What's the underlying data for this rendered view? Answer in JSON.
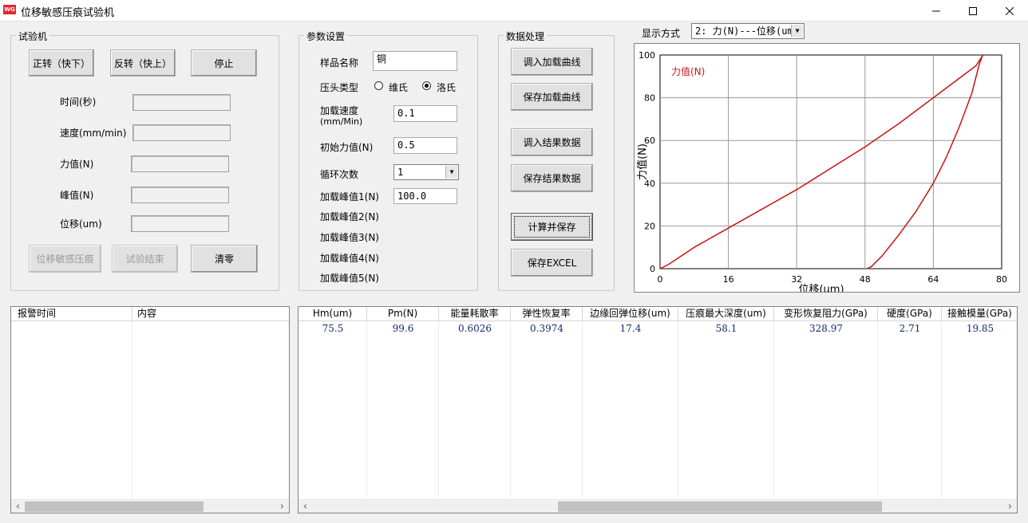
{
  "window": {
    "title": "位移敏感压痕试验机",
    "icon_text": "WG"
  },
  "machine": {
    "title": "试验机",
    "btn_forward": "正转（快下）",
    "btn_reverse": "反转（快上）",
    "btn_stop": "停止",
    "lbl_time": "时间(秒)",
    "lbl_speed": "速度(mm/min)",
    "lbl_force": "力值(N)",
    "lbl_peak": "峰值(N)",
    "lbl_disp": "位移(um)",
    "btn_indent": "位移敏感压痕",
    "btn_end": "试验结束",
    "btn_zero": "清零"
  },
  "params": {
    "title": "参数设置",
    "sample_label": "样品名称",
    "sample_value": "铜",
    "indenter_label": "压头类型",
    "opt_vickers": "维氏",
    "opt_rockwell": "洛氏",
    "selected": "洛氏",
    "speed_label_1": "加载速度",
    "speed_label_2": "(mm/Min)",
    "speed_value": "0.1",
    "init_label": "初始力值(N)",
    "init_value": "0.5",
    "cycle_label": "循环次数",
    "cycle_value": "1",
    "peak1_label": "加载峰值1(N)",
    "peak1_value": "100.0",
    "peak2_label": "加载峰值2(N)",
    "peak3_label": "加载峰值3(N)",
    "peak4_label": "加载峰值4(N)",
    "peak5_label": "加载峰值5(N)"
  },
  "processing": {
    "title": "数据处理",
    "btn_load_curve": "调入加载曲线",
    "btn_save_curve": "保存加载曲线",
    "btn_load_result": "调入结果数据",
    "btn_save_result": "保存结果数据",
    "btn_calc": "计算并保存",
    "btn_excel": "保存EXCEL"
  },
  "display": {
    "label": "显示方式",
    "value": "2: 力(N)---位移(um"
  },
  "chart_data": {
    "type": "line",
    "ylabel": "力值(N)",
    "xlabel": "位移(um)",
    "legend": "力值(N)",
    "legend_position": "top-left",
    "xlim": [
      0,
      80
    ],
    "ylim": [
      0,
      100
    ],
    "xticks": [
      "0",
      "16",
      "32",
      "48",
      "64",
      "80"
    ],
    "yticks": [
      "0",
      "20",
      "40",
      "60",
      "80",
      "100"
    ],
    "grid": true,
    "color": "#c81414",
    "series": [
      {
        "name": "力值(N)",
        "x": [
          0,
          2,
          8,
          16,
          24,
          32,
          40,
          48,
          56,
          64,
          70,
          74,
          75.5,
          74.8,
          73,
          70,
          67,
          64,
          60,
          56,
          52,
          49.5,
          48.5
        ],
        "y": [
          0,
          2,
          10,
          19,
          28,
          37,
          47,
          57,
          68,
          80,
          89,
          95,
          99.6,
          96,
          82,
          66,
          52,
          40,
          27,
          16,
          6,
          1,
          0
        ]
      }
    ]
  },
  "alarm_table": {
    "headers": [
      "报警时间",
      "内容"
    ]
  },
  "result_table": {
    "headers": [
      "Hm(um)",
      "Pm(N)",
      "能量耗散率",
      "弹性恢复率",
      "边缘回弹位移(um)",
      "压痕最大深度(um)",
      "变形恢复阻力(GPa)",
      "硬度(GPa)",
      "接触模量(GPa)"
    ],
    "rows": [
      [
        "75.5",
        "99.6",
        "0.6026",
        "0.3974",
        "17.4",
        "58.1",
        "328.97",
        "2.71",
        "19.85"
      ]
    ]
  }
}
